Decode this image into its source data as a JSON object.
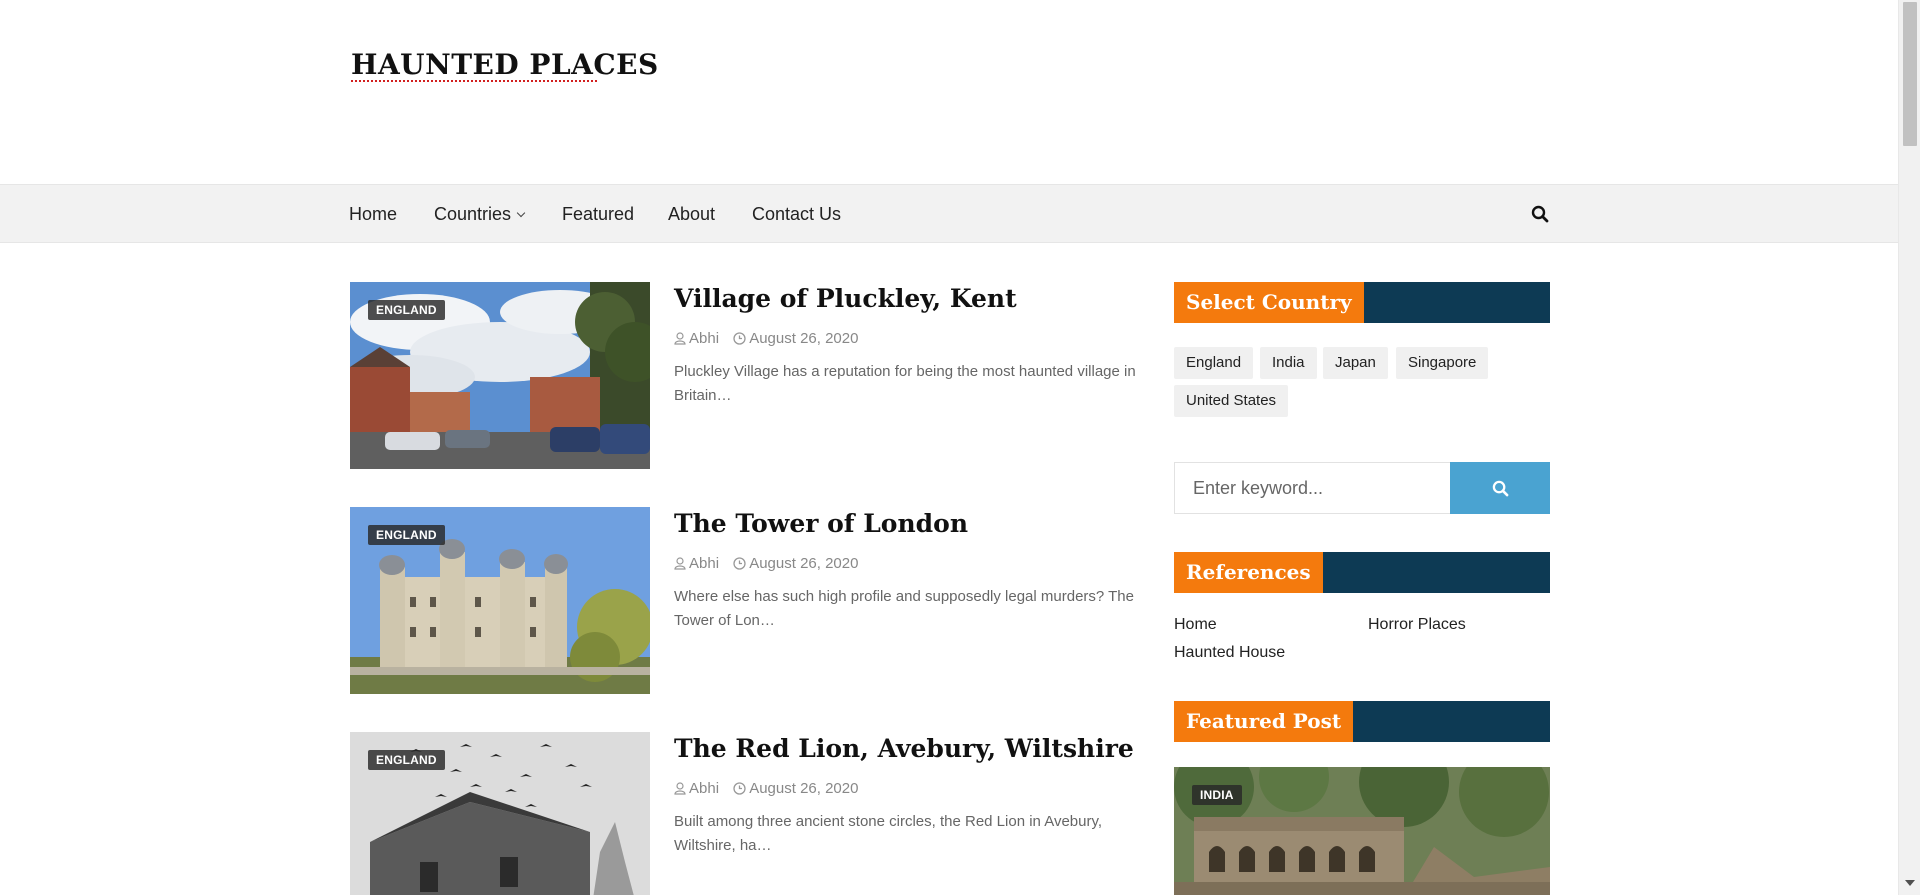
{
  "site": {
    "logo_text": "HAUNTED PLACES",
    "logo_underline_color": "#d21f1f"
  },
  "nav": {
    "items": [
      {
        "label": "Home"
      },
      {
        "label": "Countries"
      },
      {
        "label": "Featured"
      },
      {
        "label": "About"
      },
      {
        "label": "Contact Us"
      }
    ],
    "search_icon": "search-icon",
    "background": "#f2f2f2"
  },
  "posts": [
    {
      "category": "ENGLAND",
      "title": "Village of Pluckley, Kent",
      "author": "Abhi",
      "date": "August 26, 2020",
      "excerpt": "Pluckley Village has a reputation for being the most haunted village in Britain…"
    },
    {
      "category": "ENGLAND",
      "title": "The Tower of London",
      "author": "Abhi",
      "date": "August 26, 2020",
      "excerpt": "Where else has such high profile and supposedly legal murders? The Tower of Lon…"
    },
    {
      "category": "ENGLAND",
      "title": "The Red Lion, Avebury, Wiltshire",
      "author": "Abhi",
      "date": "August 26, 2020",
      "excerpt": "Built among three ancient stone circles, the Red Lion in Avebury, Wiltshire, ha…"
    }
  ],
  "sidebar": {
    "select_country": {
      "title": "Select Country",
      "tags": [
        "England",
        "India",
        "Japan",
        "Singapore",
        "United States"
      ]
    },
    "search": {
      "placeholder": "Enter keyword...",
      "button_icon": "search-icon"
    },
    "references": {
      "title": "References",
      "links": [
        "Home",
        "Horror Places",
        "Haunted House"
      ]
    },
    "featured_post": {
      "title": "Featured Post",
      "category": "INDIA"
    },
    "colors": {
      "accent_orange": "#f47a0d",
      "title_bar_navy": "#0d3a54",
      "search_button_blue": "#4aa3d1"
    }
  }
}
